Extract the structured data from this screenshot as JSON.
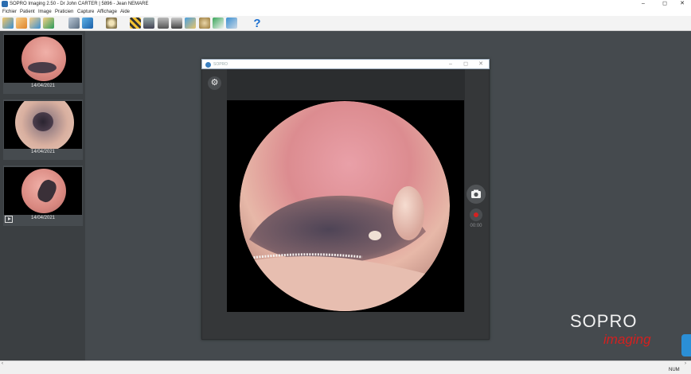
{
  "window": {
    "title": "SOPRO Imaging 2.50 - Dr John CARTER | 5896 - Jean NEMARE",
    "controls": {
      "minimize": "–",
      "maximize": "◻",
      "close": "✕"
    }
  },
  "menu": [
    "Fichier",
    "Patient",
    "Image",
    "Praticien",
    "Capture",
    "Affichage",
    "Aide"
  ],
  "toolbar": {
    "help_label": "?",
    "icons": [
      "tooth-open-icon",
      "tooth-save-icon",
      "tooth-export-icon",
      "tooth-add-icon",
      "print-icon",
      "display-icon",
      "target-icon",
      "xray-icon",
      "film-icon",
      "scanner-icon",
      "camera-icon",
      "network-icon",
      "palette-icon",
      "teeth-chart-icon",
      "import-icon"
    ]
  },
  "sidebar": {
    "thumbnails": [
      {
        "date": "14/04/2021"
      },
      {
        "date": "14/04/2021"
      },
      {
        "date": "14/04/2021"
      }
    ]
  },
  "camera_window": {
    "title": "SOPRO",
    "controls": {
      "minimize": "–",
      "maximize": "◻",
      "close": "✕"
    },
    "timer": "00:00"
  },
  "brand": {
    "line1": "SOPRO",
    "line2": "imaging"
  },
  "statusbar": {
    "indicator": "NUM"
  },
  "colors": {
    "accent_red": "#d42222",
    "brand_red": "#d32020",
    "background": "#454a4e"
  }
}
